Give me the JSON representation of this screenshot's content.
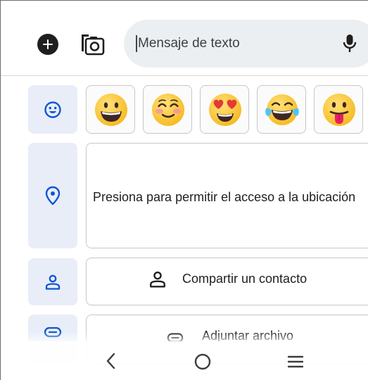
{
  "compose": {
    "placeholder": "Mensaje de texto",
    "add_icon": "add-circle-icon",
    "camera_icon": "camera-icon",
    "mic_icon": "microphone-icon"
  },
  "side_tabs": [
    {
      "id": "emoji",
      "icon": "smiley-icon"
    },
    {
      "id": "location",
      "icon": "location-pin-icon"
    },
    {
      "id": "contact",
      "icon": "person-icon"
    },
    {
      "id": "attach",
      "icon": "attachment-icon"
    }
  ],
  "emoji_row": [
    {
      "name": "grinning-face"
    },
    {
      "name": "smiling-face-blushing"
    },
    {
      "name": "heart-eyes-face"
    },
    {
      "name": "tears-of-joy-face"
    },
    {
      "name": "tongue-out-face"
    }
  ],
  "location": {
    "label": "Presiona para permitir el acceso a la ubicación"
  },
  "contact": {
    "label": "Compartir un contacto"
  },
  "attach": {
    "label": "Adjuntar archivo"
  },
  "nav": {
    "back_icon": "back-chevron-icon",
    "home_icon": "home-circle-icon",
    "recents_icon": "menu-lines-icon"
  },
  "colors": {
    "accent": "#0b57d0",
    "tile_bg": "#e8edf8",
    "pill_bg": "#eceff1"
  }
}
